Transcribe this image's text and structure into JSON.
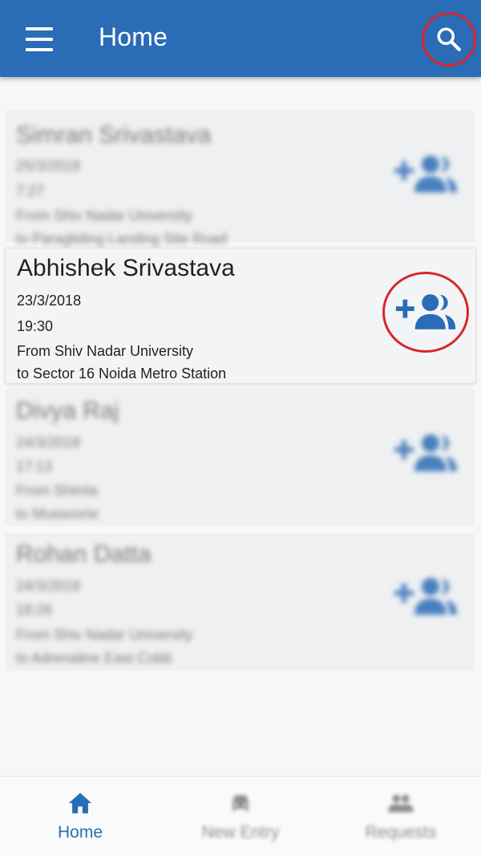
{
  "app_bar": {
    "title": "Home",
    "menu_icon": "hamburger-menu-icon",
    "search_icon": "search-icon",
    "color": "#2a6cb5"
  },
  "rides": [
    {
      "name": "Simran Srivastava",
      "date": "25/3/2018",
      "time": "7:27",
      "from": "From Shiv Nadar University",
      "to": "to Paragliding Landing Site Road",
      "action_icon": "add-group-icon",
      "blurred": true
    },
    {
      "name": "Abhishek Srivastava",
      "date": "23/3/2018",
      "time": "19:30",
      "from": "From Shiv Nadar University",
      "to": "to Sector 16 Noida Metro Station",
      "action_icon": "add-group-icon",
      "blurred": false
    },
    {
      "name": "Divya Raj",
      "date": "24/3/2018",
      "time": "17:13",
      "from": "From Shimla",
      "to": "to Mussoorie",
      "action_icon": "add-group-icon",
      "blurred": true
    },
    {
      "name": "Rohan Datta",
      "date": "24/3/2018",
      "time": "18:26",
      "from": "From Shiv Nadar University",
      "to": "to Adrenaline East Cobb",
      "action_icon": "add-group-icon",
      "blurred": true
    }
  ],
  "bottom_nav": [
    {
      "label": "Home",
      "icon": "home-icon",
      "active": true
    },
    {
      "label": "New Entry",
      "icon": "car-icon",
      "active": false
    },
    {
      "label": "Requests",
      "icon": "people-icon",
      "active": false
    }
  ],
  "colors": {
    "accent": "#2a6cb5",
    "highlight_ring": "#d9262b"
  }
}
